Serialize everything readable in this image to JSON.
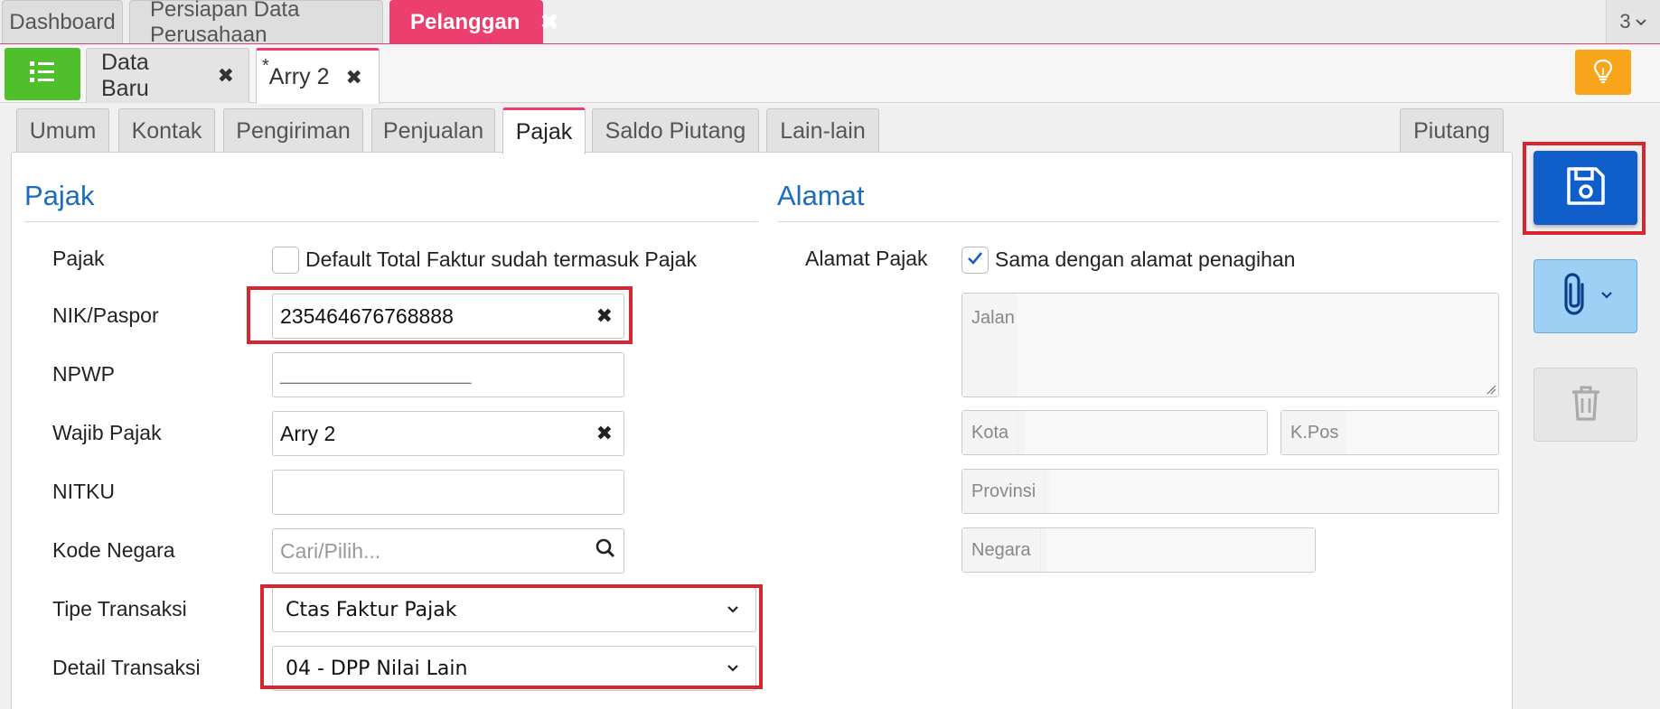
{
  "top_tabs": {
    "dashboard": "Dashboard",
    "persiapan": "Persiapan Data Perusahaan",
    "pelanggan": "Pelanggan",
    "count": "3"
  },
  "sub_tabs": {
    "data_baru": "Data Baru",
    "arry2_marker": "*",
    "arry2": "Arry 2"
  },
  "content_tabs": {
    "umum": "Umum",
    "kontak": "Kontak",
    "pengiriman": "Pengiriman",
    "penjualan": "Penjualan",
    "pajak": "Pajak",
    "saldo_piutang": "Saldo Piutang",
    "lain_lain": "Lain-lain",
    "piutang": "Piutang"
  },
  "pajak_section": {
    "title": "Pajak",
    "pajak_label": "Pajak",
    "pajak_checkbox_label": "Default Total Faktur sudah termasuk Pajak",
    "pajak_checked": false,
    "nik_label": "NIK/Paspor",
    "nik_value": "235464676768888",
    "npwp_label": "NPWP",
    "npwp_value": "___________________",
    "wajib_label": "Wajib Pajak",
    "wajib_value": "Arry 2",
    "nitku_label": "NITKU",
    "nitku_value": "",
    "kode_negara_label": "Kode Negara",
    "kode_negara_placeholder": "Cari/Pilih...",
    "tipe_label": "Tipe Transaksi",
    "tipe_value": "Ctas Faktur Pajak",
    "detail_label": "Detail Transaksi",
    "detail_value": "04 - DPP Nilai Lain"
  },
  "alamat_section": {
    "title": "Alamat",
    "alamat_pajak_label": "Alamat Pajak",
    "same_address_label": "Sama dengan alamat penagihan",
    "same_address_checked": true,
    "jalan_placeholder": "Jalan",
    "kota_placeholder": "Kota",
    "kpos_placeholder": "K.Pos",
    "provinsi_placeholder": "Provinsi",
    "negara_placeholder": "Negara"
  },
  "colors": {
    "accent_pink": "#ec3f6f",
    "menu_green": "#4fbf2b",
    "bulb_orange": "#f8a51b",
    "save_blue": "#0f5ec9",
    "section_blue": "#1a6cc2",
    "highlight_red": "#d7262f"
  },
  "icons": {
    "menu": "list-icon",
    "bulb": "lightbulb-icon",
    "save": "floppy-disk-icon",
    "attach": "paperclip-icon",
    "delete": "trash-icon",
    "search": "search-icon",
    "close": "close-icon",
    "dropdown": "chevron-down-icon",
    "check": "check-icon"
  }
}
